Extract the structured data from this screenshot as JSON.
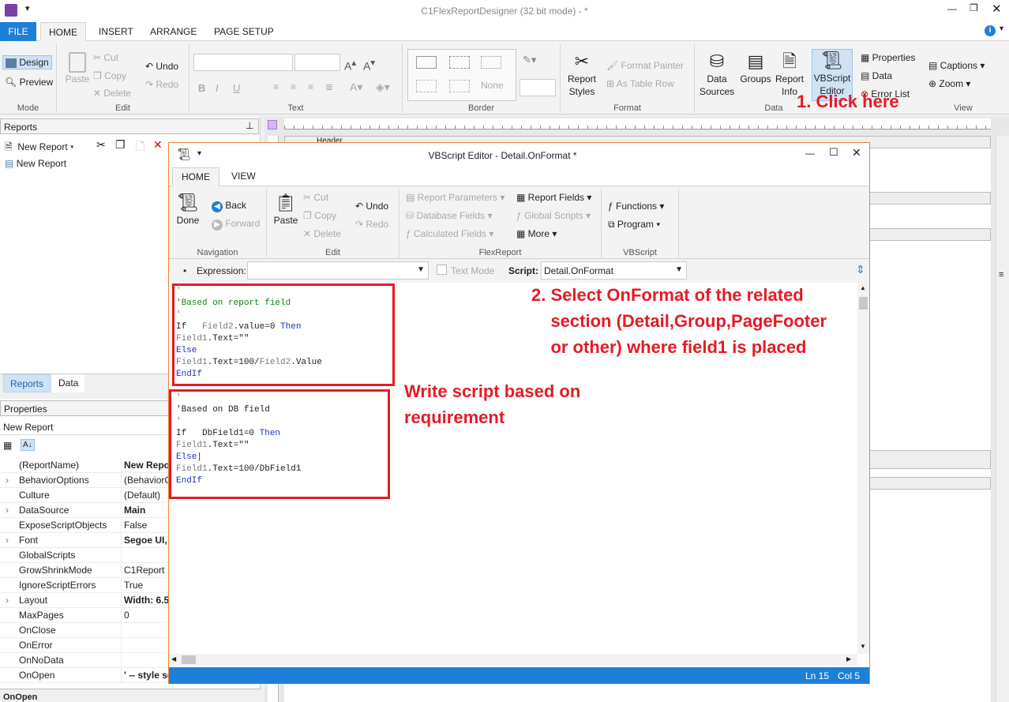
{
  "app": {
    "title": "C1FlexReportDesigner (32 bit mode) -  *"
  },
  "tabs": [
    "FILE",
    "HOME",
    "INSERT",
    "ARRANGE",
    "PAGE SETUP"
  ],
  "ribbon": {
    "mode": {
      "label": "Mode",
      "design": "Design",
      "preview": "Preview"
    },
    "edit": {
      "label": "Edit",
      "paste": "Paste",
      "cut": "Cut",
      "copy": "Copy",
      "delete": "Delete",
      "undo": "Undo",
      "redo": "Redo"
    },
    "text": {
      "label": "Text"
    },
    "border": {
      "label": "Border",
      "none": "None"
    },
    "format": {
      "label": "Format",
      "report_styles": "Report\nStyles",
      "format_painter": "Format Painter",
      "as_table_row": "As Table Row"
    },
    "data": {
      "label": "Data",
      "data_sources": "Data\nSources",
      "groups": "Groups",
      "report_info": "Report\nInfo",
      "vbscript_editor": "VBScript\nEditor",
      "properties": "Properties",
      "data": "Data",
      "error_list": "Error List"
    },
    "view": {
      "label": "View",
      "captions": "Captions",
      "zoom": "Zoom"
    }
  },
  "left": {
    "reports_title": "Reports",
    "new_report_btn": "New Report",
    "tree_item": "New Report",
    "bottom_tabs": [
      "Reports",
      "Data"
    ],
    "properties_title": "Properties",
    "object": "New Report",
    "properties": [
      {
        "name": "(ReportName)",
        "value": "New Report",
        "bold": true
      },
      {
        "name": "BehaviorOptions",
        "value": "(BehaviorO",
        "expand": true
      },
      {
        "name": "Culture",
        "value": "(Default)"
      },
      {
        "name": "DataSource",
        "value": "Main",
        "bold": true,
        "expand": true
      },
      {
        "name": "ExposeScriptObjects",
        "value": "False"
      },
      {
        "name": "Font",
        "value": "Segoe UI,",
        "bold": true,
        "expand": true
      },
      {
        "name": "GlobalScripts",
        "value": ""
      },
      {
        "name": "GrowShrinkMode",
        "value": "C1Report"
      },
      {
        "name": "IgnoreScriptErrors",
        "value": "True"
      },
      {
        "name": "Layout",
        "value": "Width: 6.5",
        "bold": true,
        "expand": true
      },
      {
        "name": "MaxPages",
        "value": "0"
      },
      {
        "name": "OnClose",
        "value": ""
      },
      {
        "name": "OnError",
        "value": ""
      },
      {
        "name": "OnNoData",
        "value": ""
      },
      {
        "name": "OnOpen",
        "value": "' -- style sc",
        "bold": true
      }
    ],
    "desc_title": "OnOpen"
  },
  "designer": {
    "header_label": "Header"
  },
  "editor": {
    "title": "VBScript Editor - Detail.OnFormat *",
    "tabs": [
      "HOME",
      "VIEW"
    ],
    "nav": {
      "label": "Navigation",
      "done": "Done",
      "back": "Back",
      "forward": "Forward"
    },
    "edit": {
      "label": "Edit",
      "paste": "Paste",
      "cut": "Cut",
      "copy": "Copy",
      "delete": "Delete",
      "undo": "Undo",
      "redo": "Redo"
    },
    "flex": {
      "label": "FlexReport",
      "report_params": "Report Parameters",
      "db_fields": "Database Fields",
      "calc_fields": "Calculated Fields",
      "report_fields": "Report Fields",
      "global_scripts": "Global Scripts",
      "more": "More"
    },
    "vbs": {
      "label": "VBScript",
      "functions": "Functions",
      "program": "Program"
    },
    "expr_label": "Expression:",
    "text_mode": "Text Mode",
    "script_label": "Script:",
    "script_value": "Detail.OnFormat",
    "status_ln": "Ln 15",
    "status_col": "Col 5"
  },
  "annotations": {
    "click_here": "1. Click here",
    "select_onformat": "2. Select OnFormat of the related\n    section (Detail,Group,PageFooter\n    or other) where field1 is placed",
    "write_script": "Write script based on\nrequirement"
  },
  "colors": {
    "accent": "#1e7fd8",
    "annotation": "#e51b26",
    "editor_border": "#f0853c"
  }
}
